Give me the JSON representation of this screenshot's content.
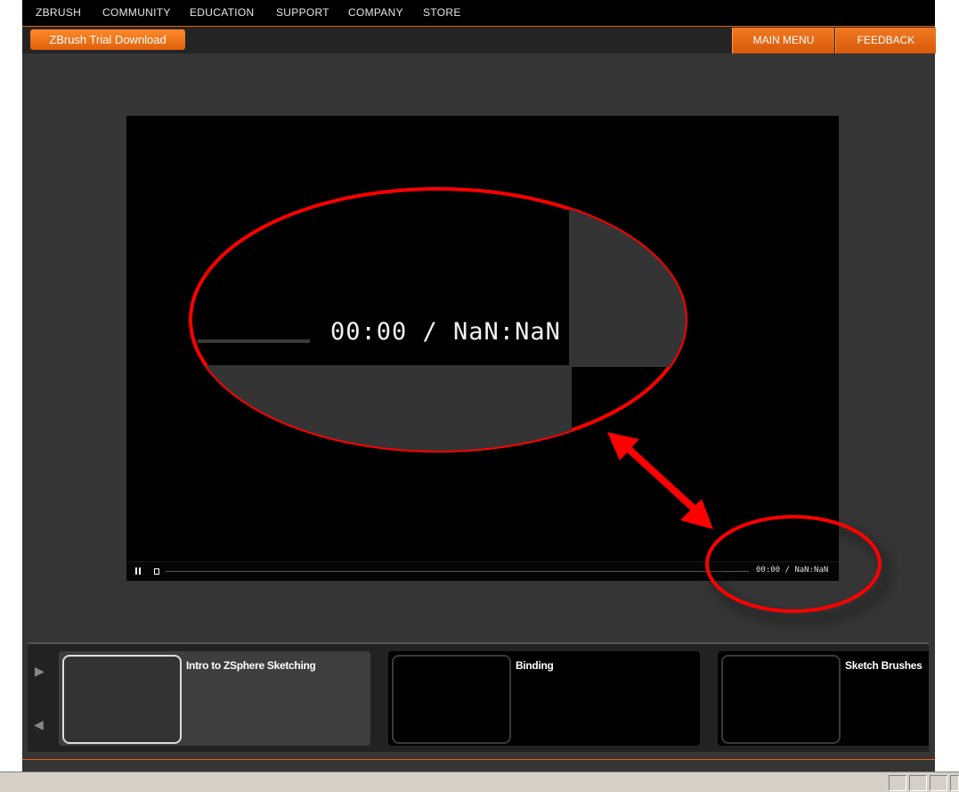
{
  "topnav": [
    "ZBRUSH",
    "COMMUNITY",
    "EDUCATION",
    "SUPPORT",
    "COMPANY",
    "STORE"
  ],
  "subbar": {
    "trial_button": "ZBrush Trial Download",
    "main_menu": "MAIN MENU",
    "feedback": "FEEDBACK"
  },
  "player": {
    "time_display": "00:00 / NaN:NaN",
    "zoom_time_display": "00:00 / NaN:NaN"
  },
  "playlist": {
    "items": [
      {
        "title": "Intro to ZSphere Sketching",
        "active": true
      },
      {
        "title": "Binding",
        "active": false
      },
      {
        "title": "Sketch Brushes",
        "active": false
      }
    ]
  },
  "colors": {
    "accent": "#e8620f",
    "annotation": "#ff0000"
  }
}
